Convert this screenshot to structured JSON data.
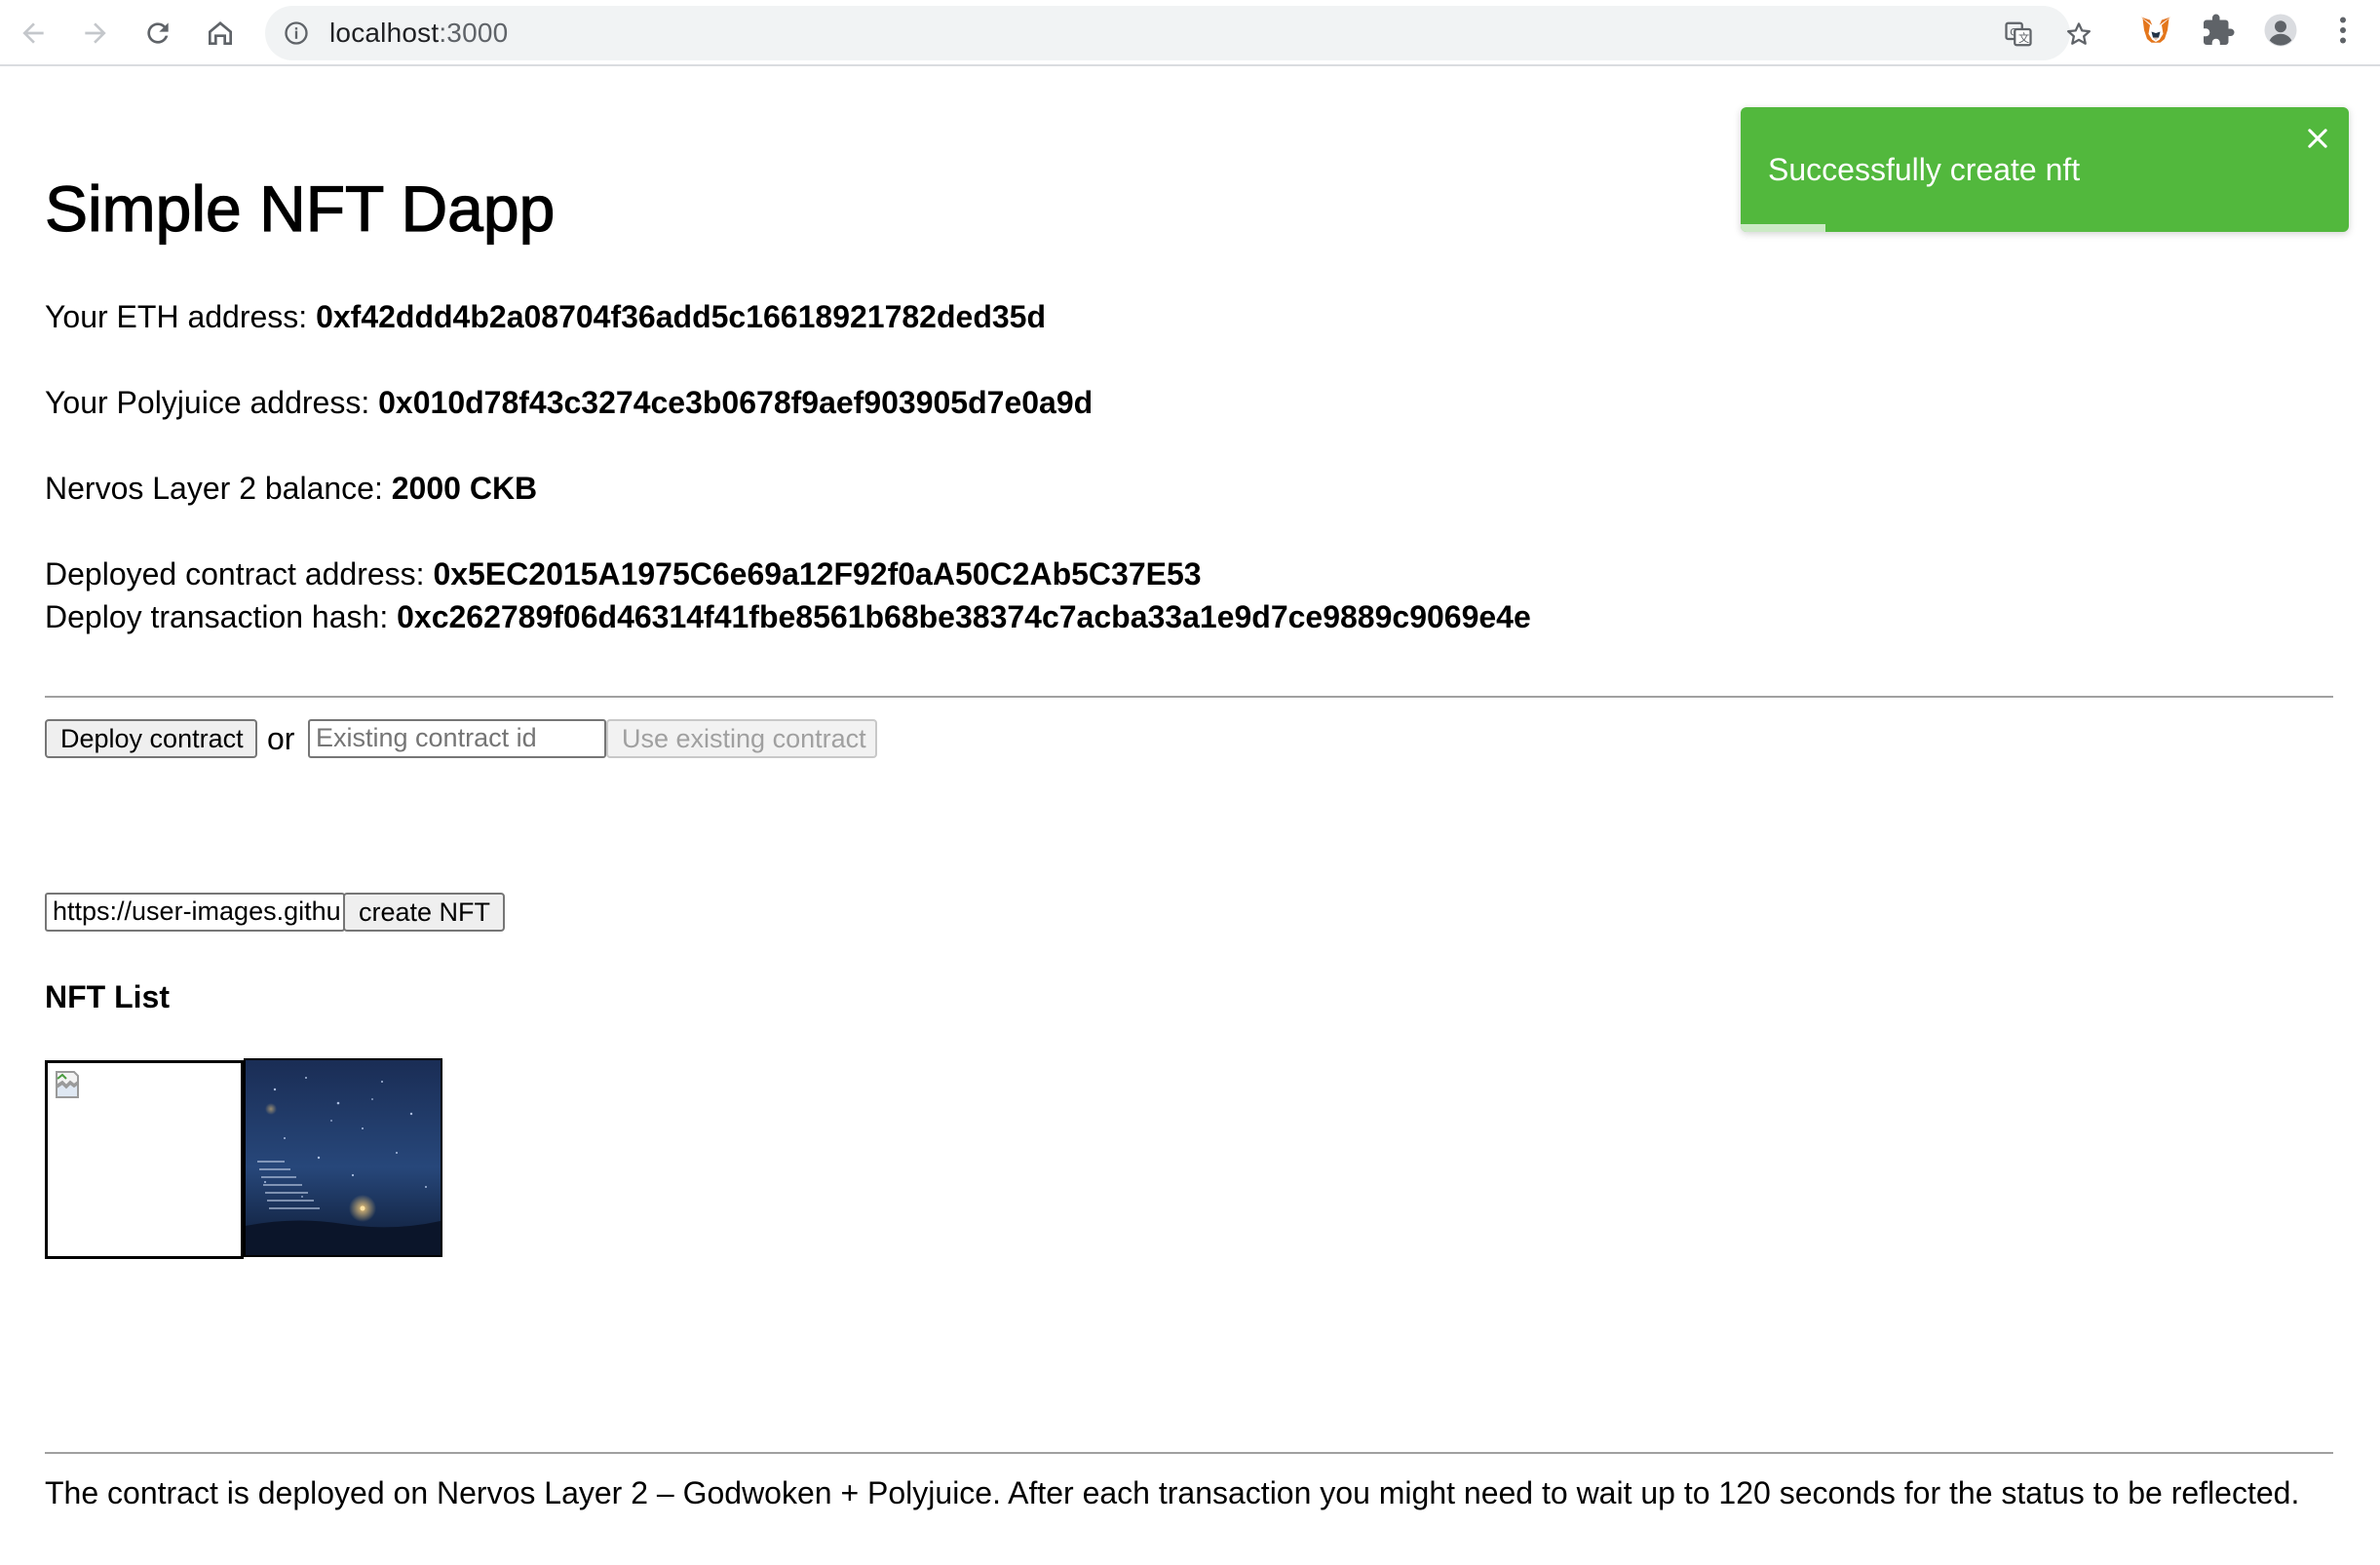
{
  "browser": {
    "url_host": "localhost",
    "url_port": ":3000",
    "icons": [
      "back-icon",
      "forward-icon",
      "reload-icon",
      "home-icon",
      "site-info-icon",
      "translate-icon",
      "bookmark-star-icon",
      "metamask-fox-icon",
      "extensions-puzzle-icon",
      "profile-avatar-icon",
      "menu-kebab-icon"
    ]
  },
  "app": {
    "title": "Simple NFT Dapp",
    "eth_label": "Your ETH address: ",
    "eth_value": "0xf42ddd4b2a08704f36add5c16618921782ded35d",
    "polyjuice_label": "Your Polyjuice address: ",
    "polyjuice_value": "0x010d78f43c3274ce3b0678f9aef903905d7e0a9d",
    "balance_label": "Nervos Layer 2 balance: ",
    "balance_value": "2000 CKB",
    "contract_label": "Deployed contract address: ",
    "contract_value": "0x5EC2015A1975C6e69a12F92f0aA50C2Ab5C37E53",
    "tx_label": "Deploy transaction hash: ",
    "tx_value": "0xc262789f06d46314f41fbe8561b68be38374c7acba33a1e9d7ce9889c9069e4e"
  },
  "controls": {
    "deploy_button": "Deploy contract",
    "or_text": "or",
    "existing_placeholder": "Existing contract id",
    "use_existing_button": "Use existing contract",
    "nft_url_value": "https://user-images.githu",
    "create_button": "create NFT"
  },
  "nft_list": {
    "heading": "NFT List",
    "items": [
      {
        "kind": "broken-image"
      },
      {
        "kind": "image",
        "description_icon": "night-sky-stairs-image"
      }
    ]
  },
  "footer": {
    "text": "The contract is deployed on Nervos Layer 2 – Godwoken + Polyjuice. After each transaction you might need to wait up to 120 seconds for the status to be reflected."
  },
  "toast": {
    "message": "Successfully create nft",
    "progress": 0.14,
    "color": "#52b83d"
  }
}
